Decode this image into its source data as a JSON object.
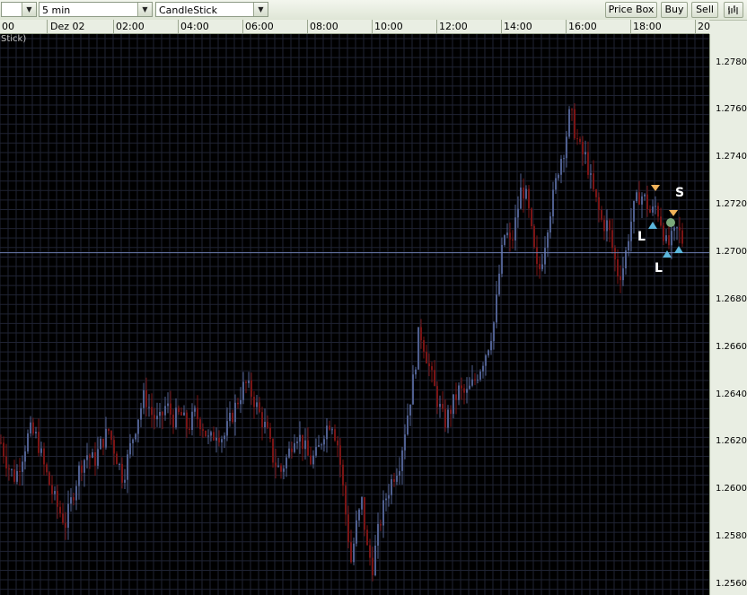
{
  "toolbar": {
    "symbol_value": "",
    "interval_value": "5 min",
    "chart_type_value": "CandleStick",
    "price_box_label": "Price Box",
    "buy_label": "Buy",
    "sell_label": "Sell",
    "chart_icon": "bar-chart-icon",
    "dropdown_icon": "chevron-down-icon"
  },
  "time_axis": {
    "labels": [
      "00",
      "Dez 02",
      "02:00",
      "04:00",
      "06:00",
      "08:00",
      "10:00",
      "12:00",
      "14:00",
      "16:00",
      "18:00",
      "20"
    ]
  },
  "chart": {
    "title_fragment": "Stick)",
    "current_price_line": 1.27,
    "markers": [
      "L",
      "L",
      "S"
    ],
    "colors": {
      "background": "#000000",
      "grid": "#1f2333",
      "bull": "#4f5f8f",
      "bear": "#7a1414",
      "price_line": "#6e7fb4",
      "buy_arrow": "#5bb6dc",
      "sell_arrow": "#f0b25a",
      "position_dot": "#7aa87a"
    }
  },
  "price_axis": {
    "labels": [
      "1.2780",
      "1.2760",
      "1.2740",
      "1.2720",
      "1.2700",
      "1.2680",
      "1.2660",
      "1.2640",
      "1.2620",
      "1.2600",
      "1.2580",
      "1.2560"
    ]
  },
  "chart_data": {
    "type": "candlestick",
    "interval": "5 min",
    "ylim": [
      1.2558,
      1.2792
    ],
    "anchors": [
      [
        0,
        1.262
      ],
      [
        8,
        1.261
      ],
      [
        16,
        1.2605
      ],
      [
        24,
        1.2615
      ],
      [
        32,
        1.2625
      ],
      [
        40,
        1.2622
      ],
      [
        48,
        1.261
      ],
      [
        56,
        1.26
      ],
      [
        64,
        1.2592
      ],
      [
        72,
        1.2586
      ],
      [
        80,
        1.2598
      ],
      [
        88,
        1.261
      ],
      [
        96,
        1.2615
      ],
      [
        104,
        1.2612
      ],
      [
        112,
        1.262
      ],
      [
        120,
        1.2625
      ],
      [
        128,
        1.2615
      ],
      [
        136,
        1.2605
      ],
      [
        144,
        1.2618
      ],
      [
        152,
        1.263
      ],
      [
        160,
        1.264
      ],
      [
        168,
        1.2632
      ],
      [
        176,
        1.2628
      ],
      [
        184,
        1.2636
      ],
      [
        192,
        1.263
      ],
      [
        200,
        1.2632
      ],
      [
        208,
        1.2626
      ],
      [
        216,
        1.2632
      ],
      [
        224,
        1.2628
      ],
      [
        232,
        1.262
      ],
      [
        240,
        1.2625
      ],
      [
        248,
        1.2622
      ],
      [
        256,
        1.263
      ],
      [
        264,
        1.2638
      ],
      [
        272,
        1.2645
      ],
      [
        280,
        1.264
      ],
      [
        288,
        1.2632
      ],
      [
        296,
        1.2625
      ],
      [
        304,
        1.2612
      ],
      [
        312,
        1.2608
      ],
      [
        320,
        1.2615
      ],
      [
        328,
        1.2625
      ],
      [
        336,
        1.262
      ],
      [
        344,
        1.2612
      ],
      [
        352,
        1.2615
      ],
      [
        360,
        1.2625
      ],
      [
        368,
        1.263
      ],
      [
        376,
        1.2618
      ],
      [
        384,
        1.259
      ],
      [
        390,
        1.257
      ],
      [
        396,
        1.2585
      ],
      [
        402,
        1.2595
      ],
      [
        408,
        1.2575
      ],
      [
        414,
        1.2568
      ],
      [
        420,
        1.2582
      ],
      [
        428,
        1.2596
      ],
      [
        436,
        1.2605
      ],
      [
        444,
        1.2612
      ],
      [
        452,
        1.263
      ],
      [
        460,
        1.2648
      ],
      [
        466,
        1.2668
      ],
      [
        472,
        1.266
      ],
      [
        478,
        1.265
      ],
      [
        486,
        1.2638
      ],
      [
        494,
        1.2628
      ],
      [
        502,
        1.2635
      ],
      [
        510,
        1.2642
      ],
      [
        518,
        1.264
      ],
      [
        526,
        1.2645
      ],
      [
        534,
        1.2652
      ],
      [
        542,
        1.266
      ],
      [
        550,
        1.2672
      ],
      [
        556,
        1.2695
      ],
      [
        562,
        1.271
      ],
      [
        568,
        1.2702
      ],
      [
        574,
        1.2715
      ],
      [
        580,
        1.2728
      ],
      [
        586,
        1.2722
      ],
      [
        592,
        1.2705
      ],
      [
        598,
        1.269
      ],
      [
        604,
        1.27
      ],
      [
        610,
        1.2715
      ],
      [
        616,
        1.2725
      ],
      [
        622,
        1.2738
      ],
      [
        628,
        1.2745
      ],
      [
        634,
        1.276
      ],
      [
        640,
        1.275
      ],
      [
        646,
        1.2742
      ],
      [
        652,
        1.274
      ],
      [
        658,
        1.2728
      ],
      [
        664,
        1.272
      ],
      [
        670,
        1.2712
      ],
      [
        676,
        1.2712
      ],
      [
        682,
        1.27
      ],
      [
        688,
        1.269
      ],
      [
        694,
        1.2695
      ],
      [
        700,
        1.271
      ],
      [
        706,
        1.272
      ],
      [
        712,
        1.2725
      ],
      [
        718,
        1.2722
      ],
      [
        724,
        1.2716
      ],
      [
        730,
        1.272
      ],
      [
        736,
        1.2712
      ],
      [
        742,
        1.2702
      ],
      [
        748,
        1.2706
      ],
      [
        754,
        1.271
      ],
      [
        760,
        1.2704
      ]
    ]
  }
}
